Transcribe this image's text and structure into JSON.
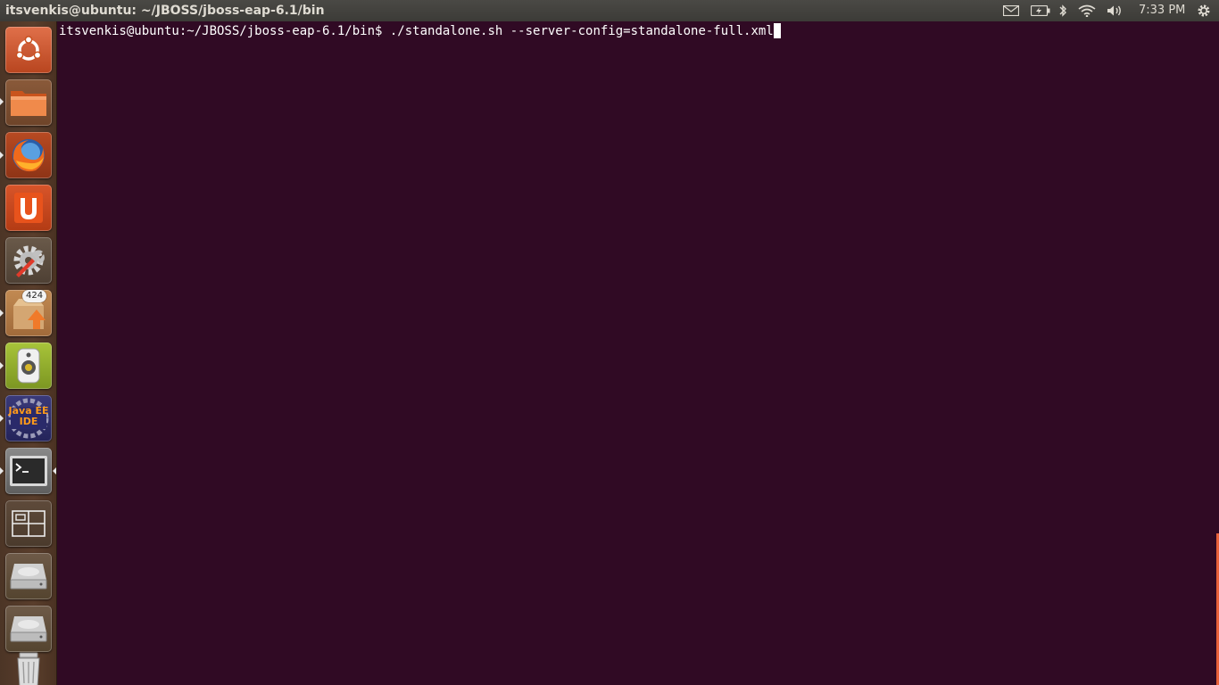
{
  "topbar": {
    "window_title": "itsvenkis@ubuntu: ~/JBOSS/jboss-eap-6.1/bin",
    "clock": "7:33 PM",
    "indicators": [
      "mail-icon",
      "battery-icon",
      "bluetooth-icon",
      "wifi-icon",
      "volume-icon",
      "gear-icon"
    ]
  },
  "launcher": {
    "items": [
      {
        "name": "dash-home",
        "icon": "ubuntu-logo-icon"
      },
      {
        "name": "files",
        "icon": "folder-icon"
      },
      {
        "name": "firefox",
        "icon": "firefox-icon"
      },
      {
        "name": "ubuntu-one",
        "icon": "ubuntu-one-icon"
      },
      {
        "name": "system-settings",
        "icon": "settings-icon"
      },
      {
        "name": "software-updater",
        "icon": "update-icon",
        "badge": "424"
      },
      {
        "name": "rhythmbox",
        "icon": "speaker-icon"
      },
      {
        "name": "eclipse-java-ee",
        "icon": "java-ee-ide-icon",
        "label": "Java EE IDE"
      },
      {
        "name": "terminal",
        "icon": "terminal-icon"
      },
      {
        "name": "workspace-switcher",
        "icon": "workspaces-icon"
      },
      {
        "name": "drive-1",
        "icon": "hard-drive-icon"
      },
      {
        "name": "drive-2",
        "icon": "hard-drive-icon"
      },
      {
        "name": "trash",
        "icon": "trash-icon"
      }
    ]
  },
  "terminal": {
    "prompt": "itsvenkis@ubuntu:~/JBOSS/jboss-eap-6.1/bin$ ",
    "command": "./standalone.sh --server-config=standalone-full.xml"
  },
  "colors": {
    "terminal_bg": "#300a24",
    "panel_bg": "#3c3b37",
    "accent": "#dd4814"
  }
}
